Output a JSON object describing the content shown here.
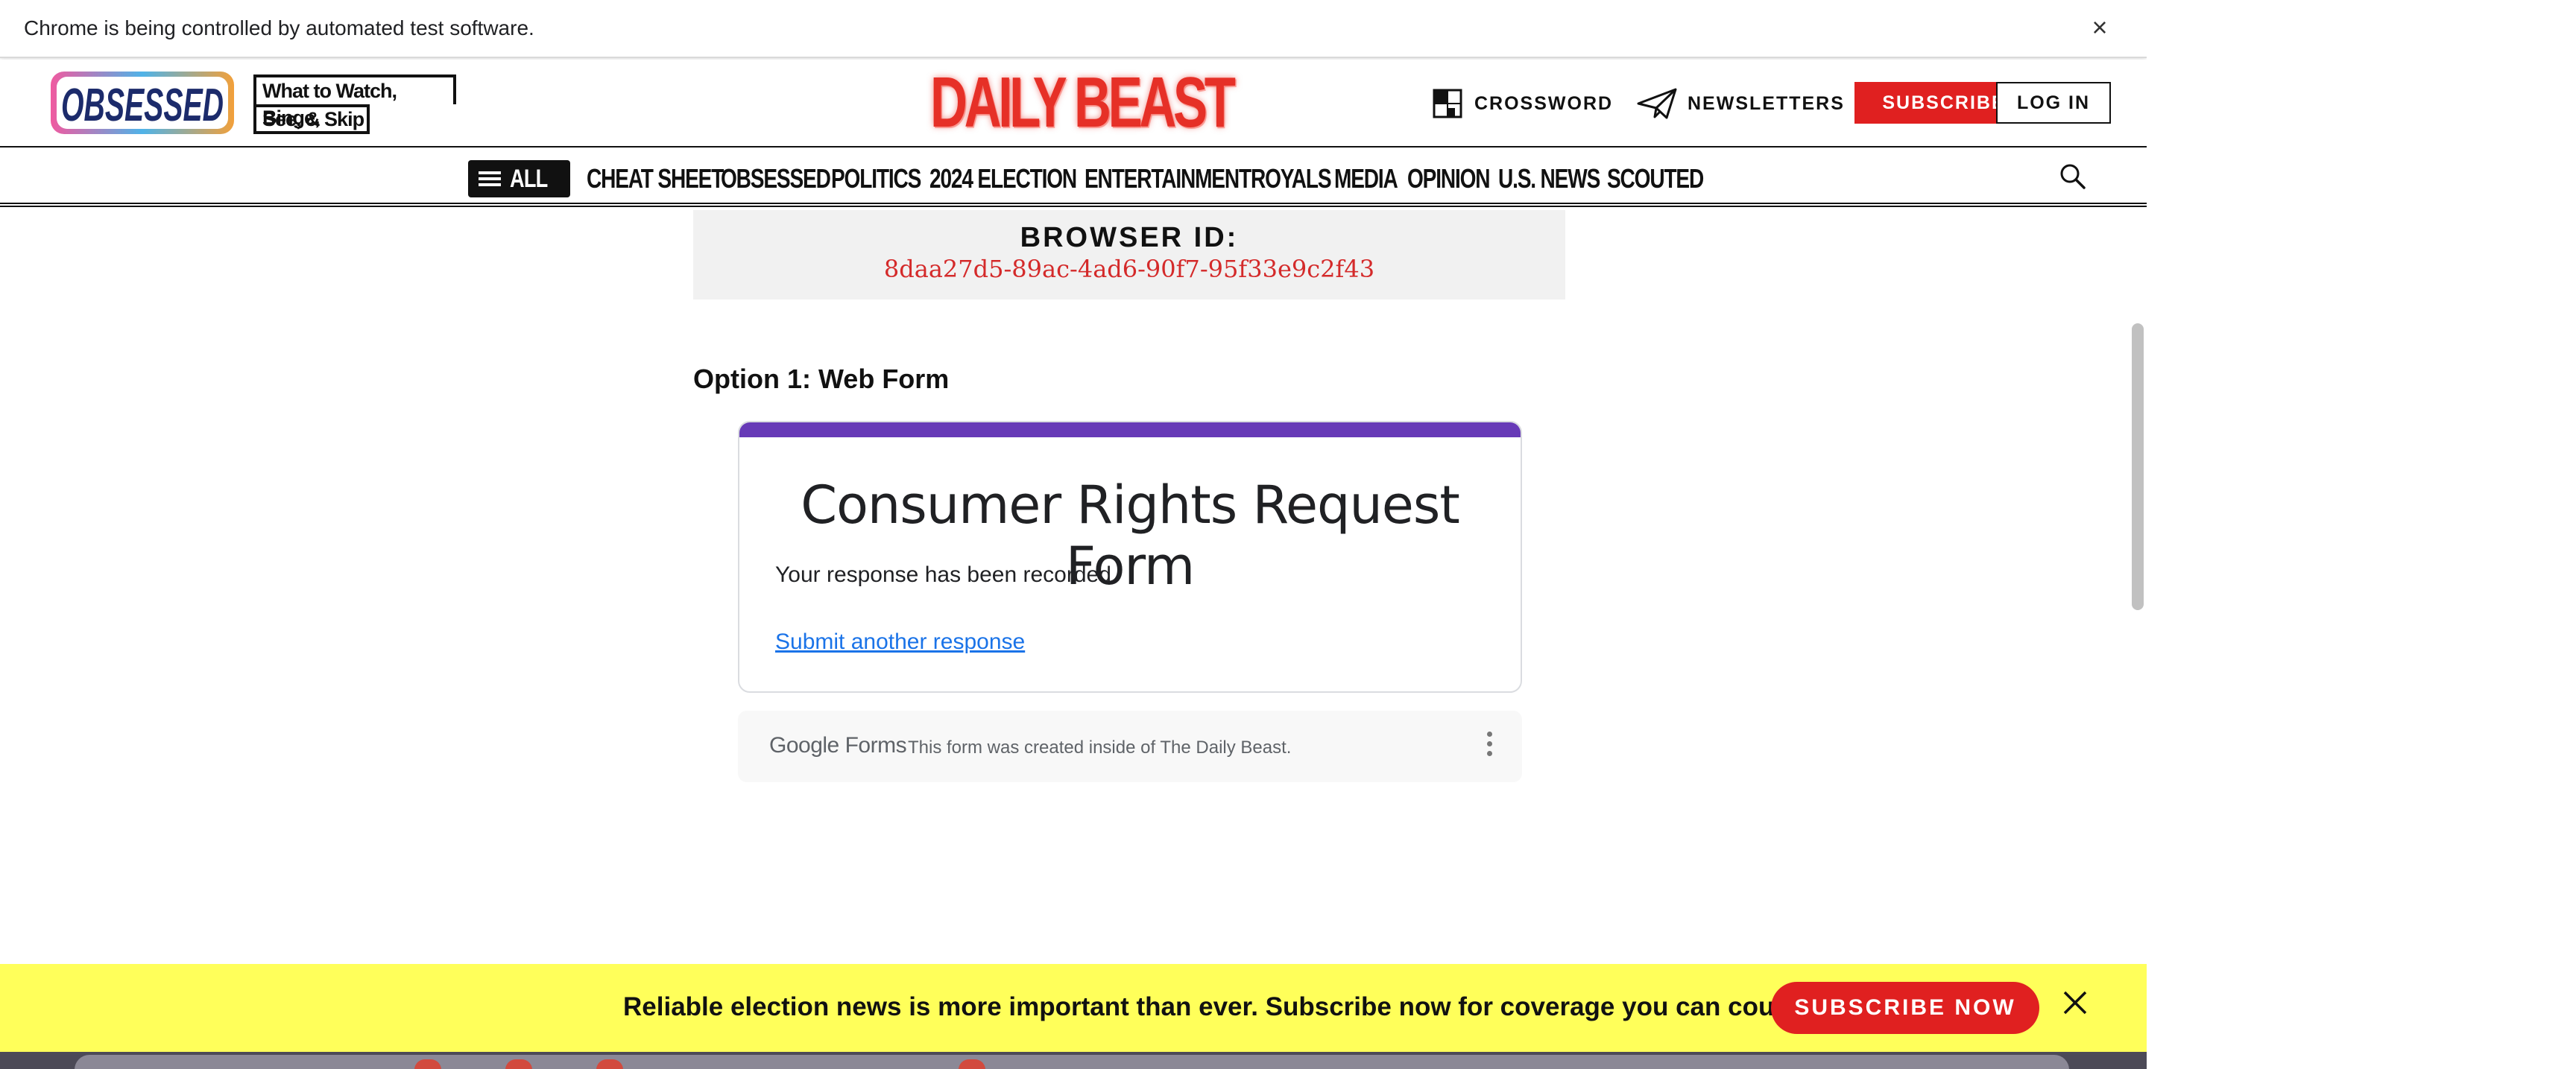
{
  "infobar": {
    "message": "Chrome is being controlled by automated test software.",
    "close_glyph": "×"
  },
  "header": {
    "obsessed_logo": "OBSESSED",
    "tagline_line1": "What to Watch, Binge,",
    "tagline_line2": "See, & Skip",
    "brand": "DAILY BEAST",
    "crossword_label": "CROSSWORD",
    "newsletters_label": "NEWSLETTERS",
    "subscribe_label": "SUBSCRIBE",
    "login_label": "LOG IN",
    "brand_color": "#e63027"
  },
  "nav": {
    "all_label": "ALL",
    "items": [
      "CHEAT SHEET",
      "OBSESSED",
      "POLITICS",
      "2024 ELECTION",
      "ENTERTAINMENT",
      "ROYALS",
      "MEDIA",
      "OPINION",
      "U.S. NEWS",
      "SCOUTED"
    ],
    "search_icon": "search-icon"
  },
  "browser_id": {
    "title": "BROWSER ID:",
    "value": "8daa27d5-89ac-4ad6-90f7-95f33e9c2f43"
  },
  "main": {
    "option_heading": "Option 1: Web Form"
  },
  "form": {
    "accent_color": "#673ab7",
    "title": "Consumer Rights Request Form",
    "message": "Your response has been recorded.",
    "link": "Submit another response"
  },
  "forms_footer": {
    "logo": "Google Forms",
    "note": "This form was created inside of The Daily Beast."
  },
  "promo": {
    "text": "Reliable election news is more important than ever. Subscribe now for coverage you can count on.",
    "button": "SUBSCRIBE NOW",
    "background": "#ffff5a"
  }
}
